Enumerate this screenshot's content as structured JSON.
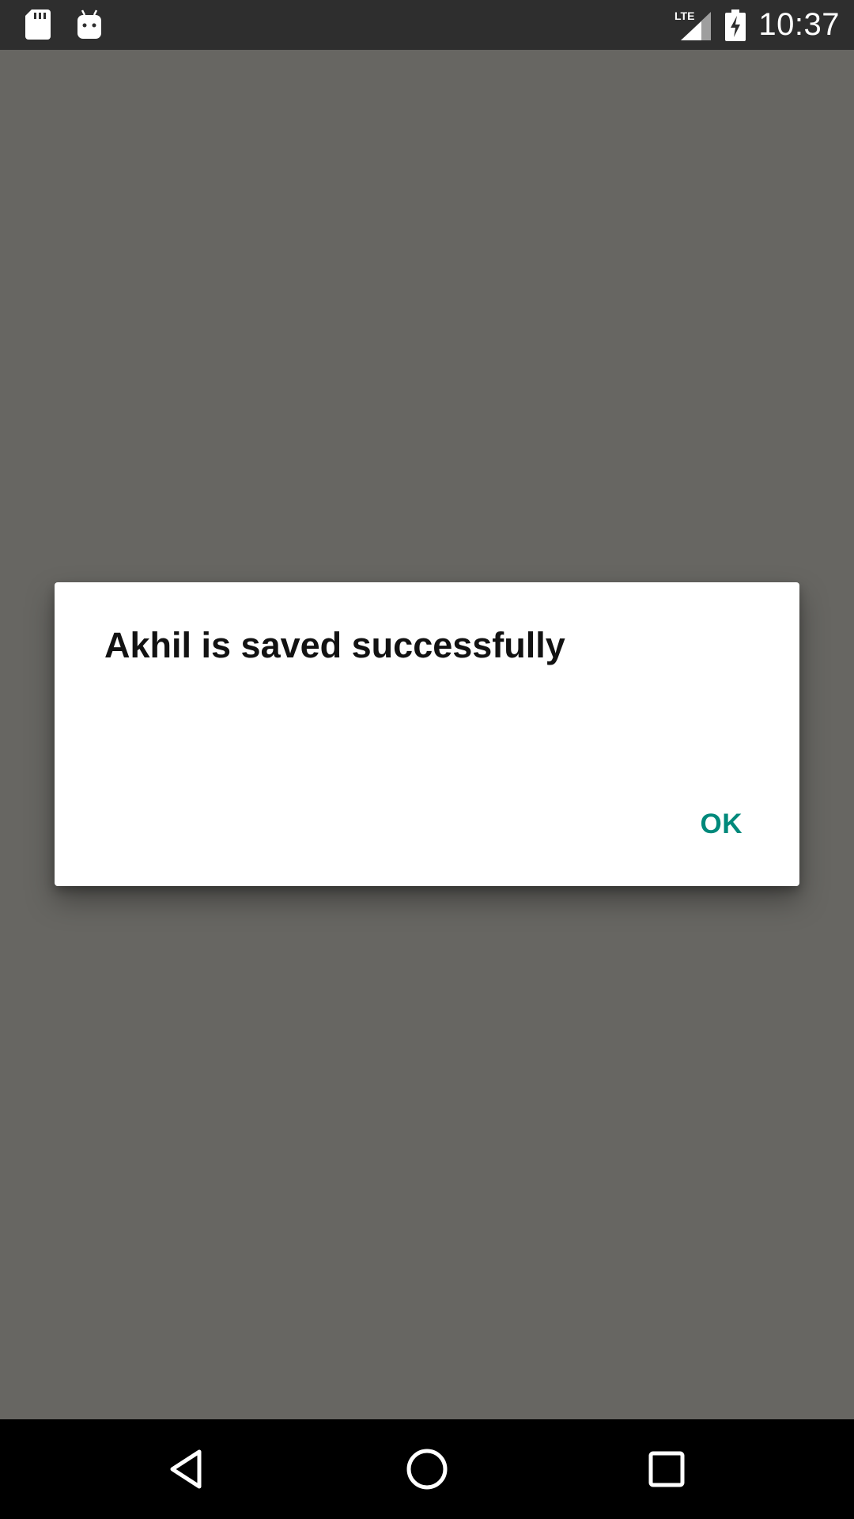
{
  "status_bar": {
    "time": "10:37",
    "network_label": "LTE",
    "icons": [
      "sd-card-icon",
      "android-icon",
      "signal-icon",
      "battery-charging-icon"
    ]
  },
  "dialog": {
    "message": "Akhil is saved successfully",
    "ok_label": "OK"
  },
  "nav_bar": {
    "icons": [
      "back-icon",
      "home-icon",
      "recents-icon"
    ]
  },
  "colors": {
    "accent": "#00897b",
    "scrim_background": "#676662",
    "status_bar": "#2e2e2e",
    "nav_bar": "#000000"
  }
}
